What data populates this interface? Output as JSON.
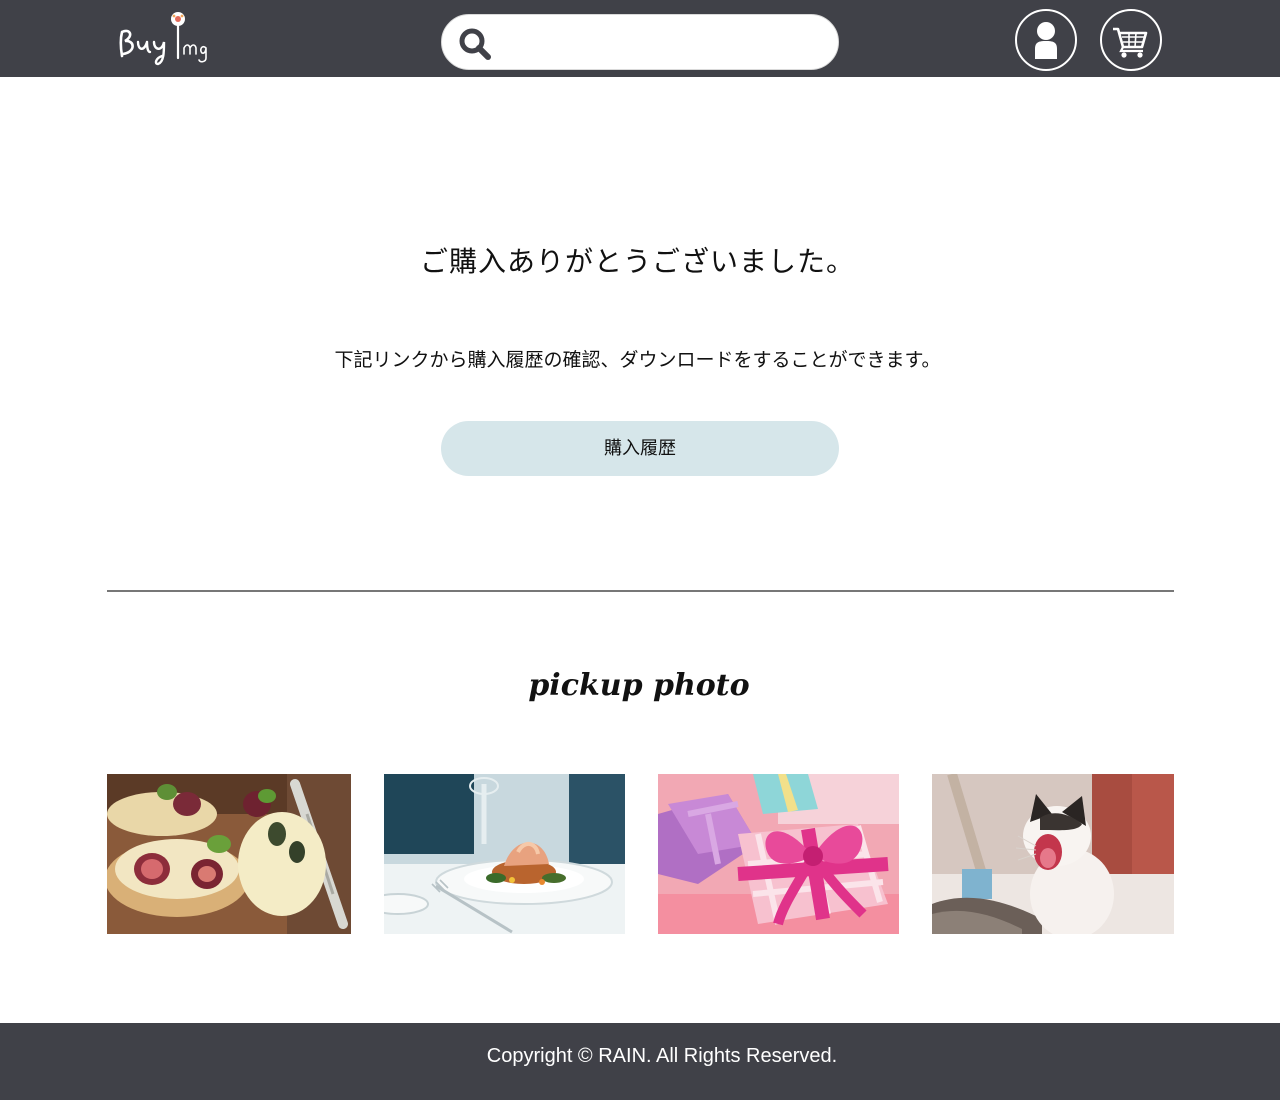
{
  "header": {
    "logo_text": "BuyImg",
    "search": {
      "value": "",
      "placeholder": ""
    },
    "icons": {
      "search": "search-icon",
      "user": "user-icon",
      "cart": "cart-icon"
    }
  },
  "main": {
    "thanks_message": "ご購入ありがとうございました。",
    "info_message": "下記リンクから購入履歴の確認、ダウンロードをすることができます。",
    "history_button_label": "購入履歴"
  },
  "pickup": {
    "title": "pickup photo",
    "photos": [
      {
        "subject": "fig-bruschetta"
      },
      {
        "subject": "restaurant-dish"
      },
      {
        "subject": "pink-gift-box"
      },
      {
        "subject": "yawning-kitten"
      }
    ]
  },
  "footer": {
    "copyright": "Copyright © RAIN. All Rights Reserved."
  },
  "colors": {
    "header_bg": "#404148",
    "footer_bg": "#404148",
    "button_bg": "#d6e6ea",
    "divider": "#777777"
  }
}
